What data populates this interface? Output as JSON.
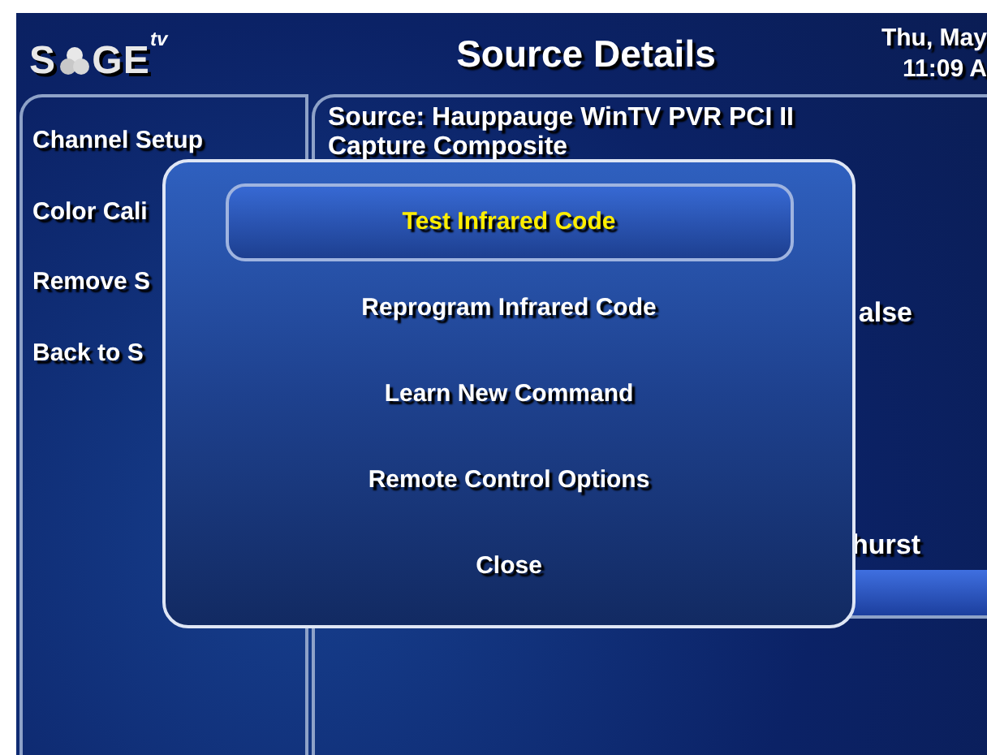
{
  "logo": {
    "left": "S",
    "right": "GE",
    "superscript": "tv"
  },
  "header": {
    "title": "Source Details",
    "date": "Thu, May",
    "time": "11:09 A"
  },
  "sidebar": {
    "items": [
      {
        "label": "Channel Setup"
      },
      {
        "label": "Color Cali"
      },
      {
        "label": "Remove S"
      },
      {
        "label": "Back to S"
      }
    ]
  },
  "details": {
    "source_line_1": "Source: Hauppauge WinTV PVR PCI II",
    "source_line_2": "Capture Composite",
    "value_1": "alse",
    "value_2": "hurst"
  },
  "dialog": {
    "items": [
      {
        "label": "Test Infrared Code",
        "selected": true
      },
      {
        "label": "Reprogram Infrared Code",
        "selected": false
      },
      {
        "label": "Learn New Command",
        "selected": false
      },
      {
        "label": "Remote Control Options",
        "selected": false
      },
      {
        "label": "Close",
        "selected": false
      }
    ]
  }
}
